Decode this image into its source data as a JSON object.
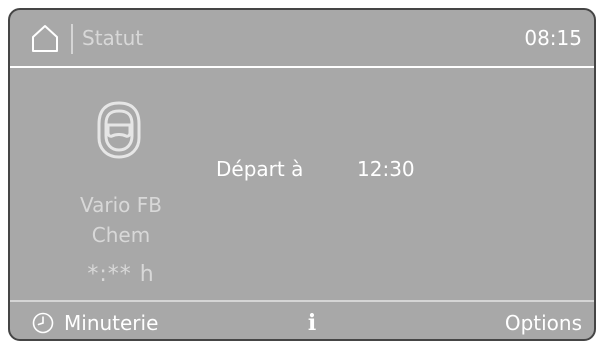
{
  "header": {
    "title": "Statut",
    "clock": "08:15",
    "home_icon": "home-icon"
  },
  "program": {
    "icon": "respirator-mask-icon",
    "name_line1": "Vario FB",
    "name_line2": "Chem",
    "remaining_time": "*:** h"
  },
  "start": {
    "label": "Départ à",
    "time": "12:30"
  },
  "footer": {
    "timer_label": "Minuterie",
    "timer_icon": "clock-icon",
    "info_glyph": "i",
    "info_icon": "info-icon",
    "options_label": "Options"
  },
  "colors": {
    "screen_bg": "#a8a8a8",
    "bezel": "#454545",
    "text_primary": "#ffffff",
    "text_muted": "#d8d8d8"
  }
}
